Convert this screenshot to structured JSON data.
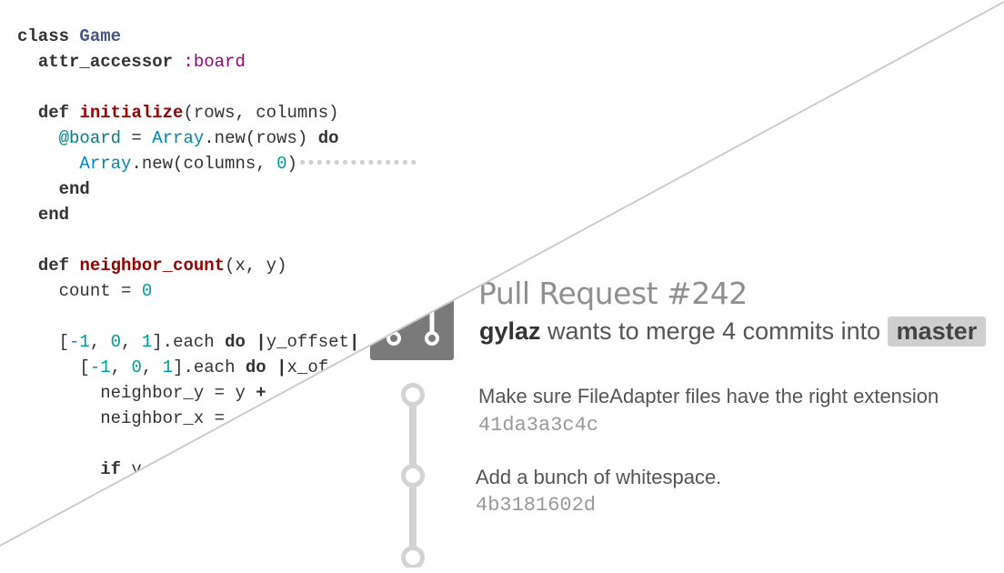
{
  "code": {
    "lines": [
      [
        {
          "t": "class ",
          "c": "kw"
        },
        {
          "t": "Game",
          "c": "cls"
        }
      ],
      [
        {
          "t": "  "
        },
        {
          "t": "attr_accessor",
          "c": "kw"
        },
        {
          "t": " "
        },
        {
          "t": ":board",
          "c": "sym"
        }
      ],
      [
        {
          "t": " "
        }
      ],
      [
        {
          "t": "  "
        },
        {
          "t": "def",
          "c": "kw"
        },
        {
          "t": " "
        },
        {
          "t": "initialize",
          "c": "fn"
        },
        {
          "t": "(rows, columns)"
        }
      ],
      [
        {
          "t": "    "
        },
        {
          "t": "@board",
          "c": "ivar"
        },
        {
          "t": " = "
        },
        {
          "t": "Array",
          "c": "const"
        },
        {
          "t": ".new(rows) "
        },
        {
          "t": "do",
          "c": "kw"
        }
      ],
      [
        {
          "t": "      "
        },
        {
          "t": "Array",
          "c": "const"
        },
        {
          "t": ".new(columns, "
        },
        {
          "t": "0",
          "c": "num"
        },
        {
          "t": ")"
        },
        {
          "t": "••••••••••••••",
          "c": "dots"
        }
      ],
      [
        {
          "t": "    "
        },
        {
          "t": "end",
          "c": "kw"
        }
      ],
      [
        {
          "t": "  "
        },
        {
          "t": "end",
          "c": "kw"
        }
      ],
      [
        {
          "t": " "
        }
      ],
      [
        {
          "t": "  "
        },
        {
          "t": "def",
          "c": "kw"
        },
        {
          "t": " "
        },
        {
          "t": "neighbor_count",
          "c": "fn"
        },
        {
          "t": "(x, y)"
        }
      ],
      [
        {
          "t": "    count = "
        },
        {
          "t": "0",
          "c": "num"
        }
      ],
      [
        {
          "t": " "
        }
      ],
      [
        {
          "t": "    ["
        },
        {
          "t": "-1",
          "c": "num"
        },
        {
          "t": ", "
        },
        {
          "t": "0",
          "c": "num"
        },
        {
          "t": ", "
        },
        {
          "t": "1",
          "c": "num"
        },
        {
          "t": "].each "
        },
        {
          "t": "do",
          "c": "kw"
        },
        {
          "t": " "
        },
        {
          "t": "|",
          "c": "kw"
        },
        {
          "t": "y_offset"
        },
        {
          "t": "|",
          "c": "kw"
        }
      ],
      [
        {
          "t": "      ["
        },
        {
          "t": "-1",
          "c": "num"
        },
        {
          "t": ", "
        },
        {
          "t": "0",
          "c": "num"
        },
        {
          "t": ", "
        },
        {
          "t": "1",
          "c": "num"
        },
        {
          "t": "].each "
        },
        {
          "t": "do",
          "c": "kw"
        },
        {
          "t": " "
        },
        {
          "t": "|",
          "c": "kw"
        },
        {
          "t": "x_of"
        }
      ],
      [
        {
          "t": "        neighbor_y = y "
        },
        {
          "t": "+",
          "c": "kw"
        }
      ],
      [
        {
          "t": "        neighbor_x ="
        }
      ],
      [
        {
          "t": " "
        }
      ],
      [
        {
          "t": "        "
        },
        {
          "t": "if",
          "c": "kw"
        },
        {
          "t": " y"
        }
      ]
    ]
  },
  "pull_request": {
    "title": "Pull Request #242",
    "author": "gylaz",
    "merge_text": " wants to merge 4 commits into ",
    "branch": "master"
  },
  "commits": [
    {
      "message": "Make sure FileAdapter files have the right extension",
      "sha": "41da3a3c4c"
    },
    {
      "message": "Add a bunch of whitespace.",
      "sha": "4b3181602d"
    }
  ],
  "icons": {
    "pr_icon": "git-pull-request-icon",
    "commit_node": "git-commit-node-icon"
  },
  "colors": {
    "keyword": "#333333",
    "class": "#445588",
    "symbol": "#990073",
    "function": "#990000",
    "ivar": "#008080",
    "constant": "#0086B3",
    "number": "#009999",
    "divider": "#cccccc",
    "pr_icon_bg": "#7a7a7a"
  }
}
